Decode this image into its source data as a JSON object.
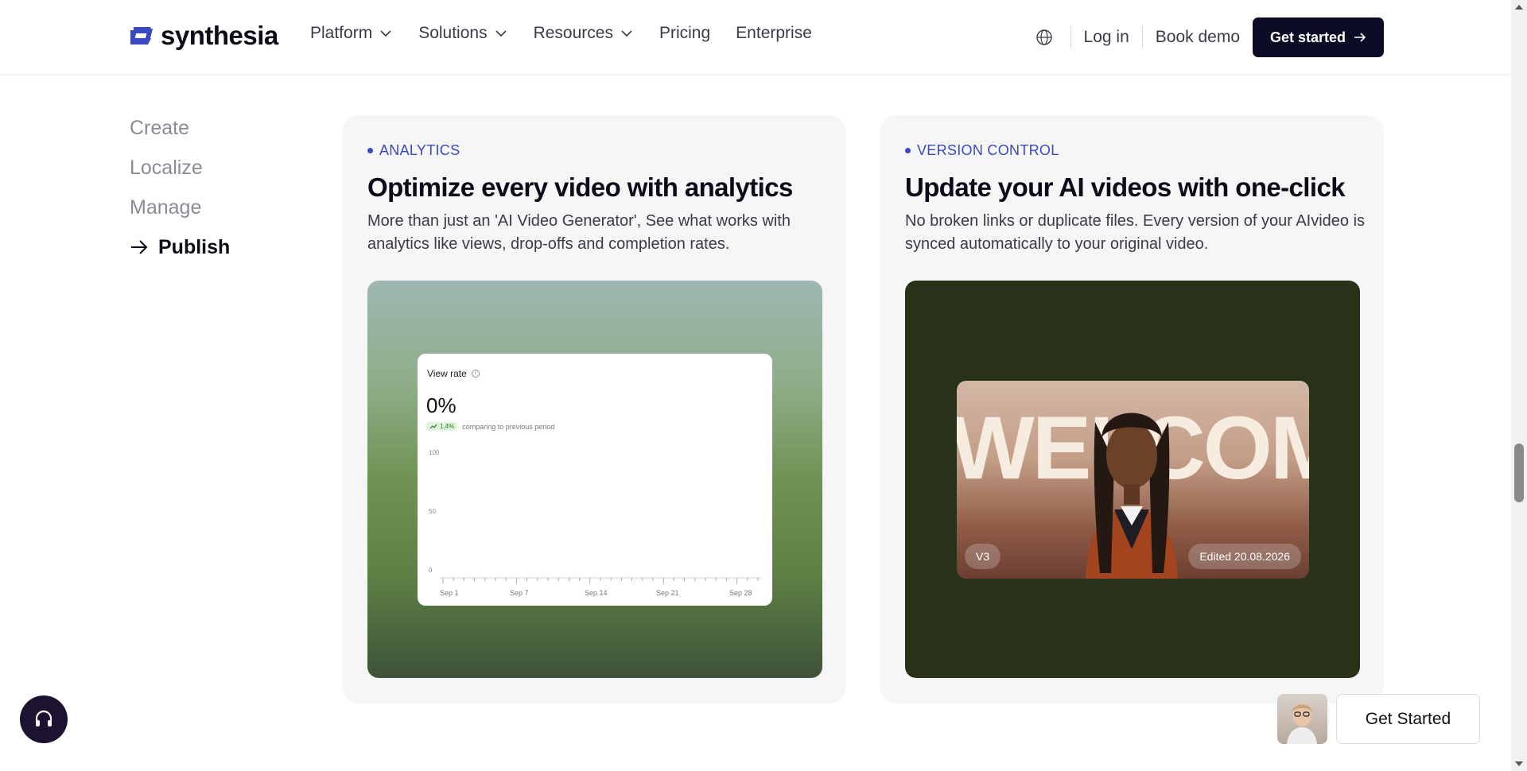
{
  "header": {
    "logo_text": "synthesia",
    "nav": [
      {
        "label": "Platform",
        "dropdown": true
      },
      {
        "label": "Solutions",
        "dropdown": true
      },
      {
        "label": "Resources",
        "dropdown": true
      },
      {
        "label": "Pricing",
        "dropdown": false
      },
      {
        "label": "Enterprise",
        "dropdown": false
      }
    ],
    "login_label": "Log in",
    "demo_label": "Book demo",
    "cta_label": "Get started",
    "brand_color": "#3b48c4"
  },
  "side_menu": {
    "items": [
      "Create",
      "Localize",
      "Manage",
      "Publish"
    ],
    "active_item": "Publish"
  },
  "cards": [
    {
      "tag": "ANALYTICS",
      "title": "Optimize every video with analytics",
      "description": "More than just an 'AI Video Generator', See what works with analytics like views, drop-offs and completion rates.",
      "panel": {
        "title": "View rate",
        "value": "0%",
        "trend": "1.4%",
        "trend_text": "comparing to previous period",
        "y_ticks": [
          "100",
          "50",
          "0"
        ],
        "x_ticks": [
          "Sep 1",
          "Sep 7",
          "Sep 14",
          "Sep 21",
          "Sep 28"
        ]
      }
    },
    {
      "tag": "VERSION CONTROL",
      "title": "Update your AI videos with one-click",
      "description": "No broken links or duplicate files. Every version of your AIvideo is synced automatically to your original video.",
      "video": {
        "background_text": "WELCOME",
        "version_badge": "V3",
        "edited_badge": "Edited 20.08.2026"
      }
    }
  ],
  "floating": {
    "cta_label": "Get Started",
    "help_icon": "headset-icon"
  }
}
